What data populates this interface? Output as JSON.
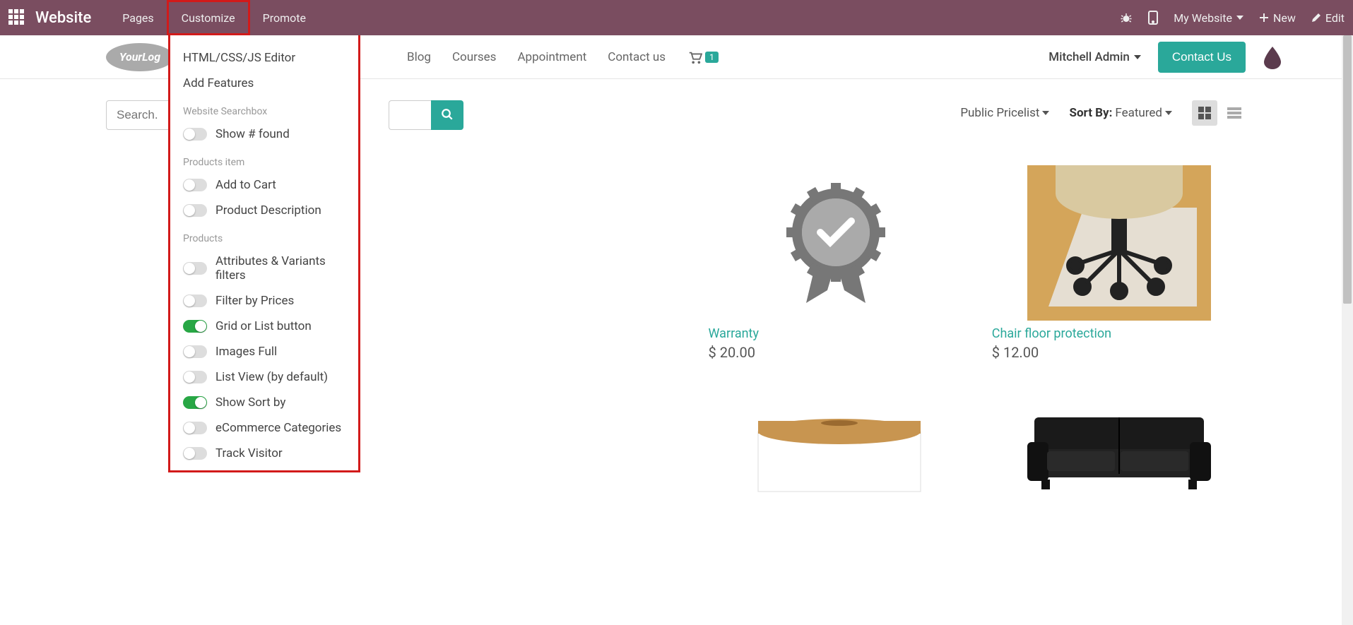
{
  "topbar": {
    "brand": "Website",
    "menu": {
      "pages": "Pages",
      "customize": "Customize",
      "promote": "Promote"
    },
    "right": {
      "my_website": "My Website",
      "new": "New",
      "edit": "Edit"
    }
  },
  "secondary": {
    "logo": "YourLog",
    "blog": "Blog",
    "courses": "Courses",
    "appointment": "Appointment",
    "contact_us": "Contact us",
    "cart_count": "1",
    "user": "Mitchell Admin",
    "contact_btn": "Contact Us"
  },
  "search": {
    "placeholder": "Search..."
  },
  "filters": {
    "pricelist": "Public Pricelist",
    "sort_by_label": "Sort By:",
    "sort_value": "Featured"
  },
  "customize_dd": {
    "items_top": [
      "HTML/CSS/JS Editor",
      "Add Features"
    ],
    "section1_title": "Website Searchbox",
    "section1_items": [
      {
        "label": "Show # found",
        "on": false
      }
    ],
    "section2_title": "Products item",
    "section2_items": [
      {
        "label": "Add to Cart",
        "on": false
      },
      {
        "label": "Product Description",
        "on": false
      }
    ],
    "section3_title": "Products",
    "section3_items": [
      {
        "label": "Attributes & Variants filters",
        "on": false
      },
      {
        "label": "Filter by Prices",
        "on": false
      },
      {
        "label": "Grid or List button",
        "on": true
      },
      {
        "label": "Images Full",
        "on": false
      },
      {
        "label": "List View (by default)",
        "on": false
      },
      {
        "label": "Show Sort by",
        "on": true
      },
      {
        "label": "eCommerce Categories",
        "on": false
      },
      {
        "label": "Track Visitor",
        "on": false
      }
    ]
  },
  "products": [
    {
      "title": "Warranty",
      "price": "$ 20.00"
    },
    {
      "title": "Chair floor protection",
      "price": "$ 12.00"
    }
  ]
}
